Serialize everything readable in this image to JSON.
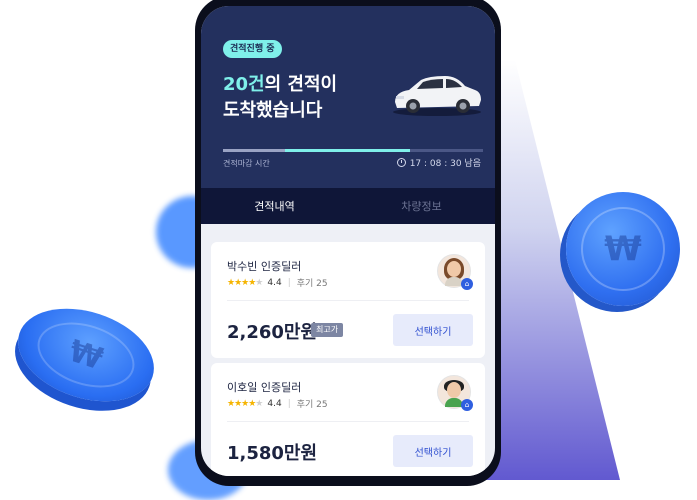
{
  "status_badge": "견적진행 중",
  "headline": {
    "count": "20건",
    "line1_rest": "의 견적이",
    "line2": "도착했습니다"
  },
  "deadline": {
    "label": "견적마감 시간",
    "remaining": "17 : 08 : 30 남음",
    "progress": 0.72
  },
  "tabs": [
    {
      "label": "견적내역",
      "active": true
    },
    {
      "label": "차량정보",
      "active": false
    }
  ],
  "quotes": [
    {
      "dealer": "박수빈 인증딜러",
      "rating": "4.4",
      "reviews": "후기 25",
      "price": "2,260만원",
      "tag": "최고가",
      "button": "선택하기"
    },
    {
      "dealer": "이호일 인증딜러",
      "rating": "4.4",
      "reviews": "후기 25",
      "price": "1,580만원",
      "button": "선택하기"
    }
  ],
  "icons": {
    "coin": "won-coin-icon",
    "clock": "clock-icon",
    "verified": "home-badge-icon"
  },
  "colors": {
    "hero_bg": "#23305e",
    "accent": "#7ff0ea",
    "tab_bg": "#0f1638",
    "button_text": "#2f4fd0"
  }
}
